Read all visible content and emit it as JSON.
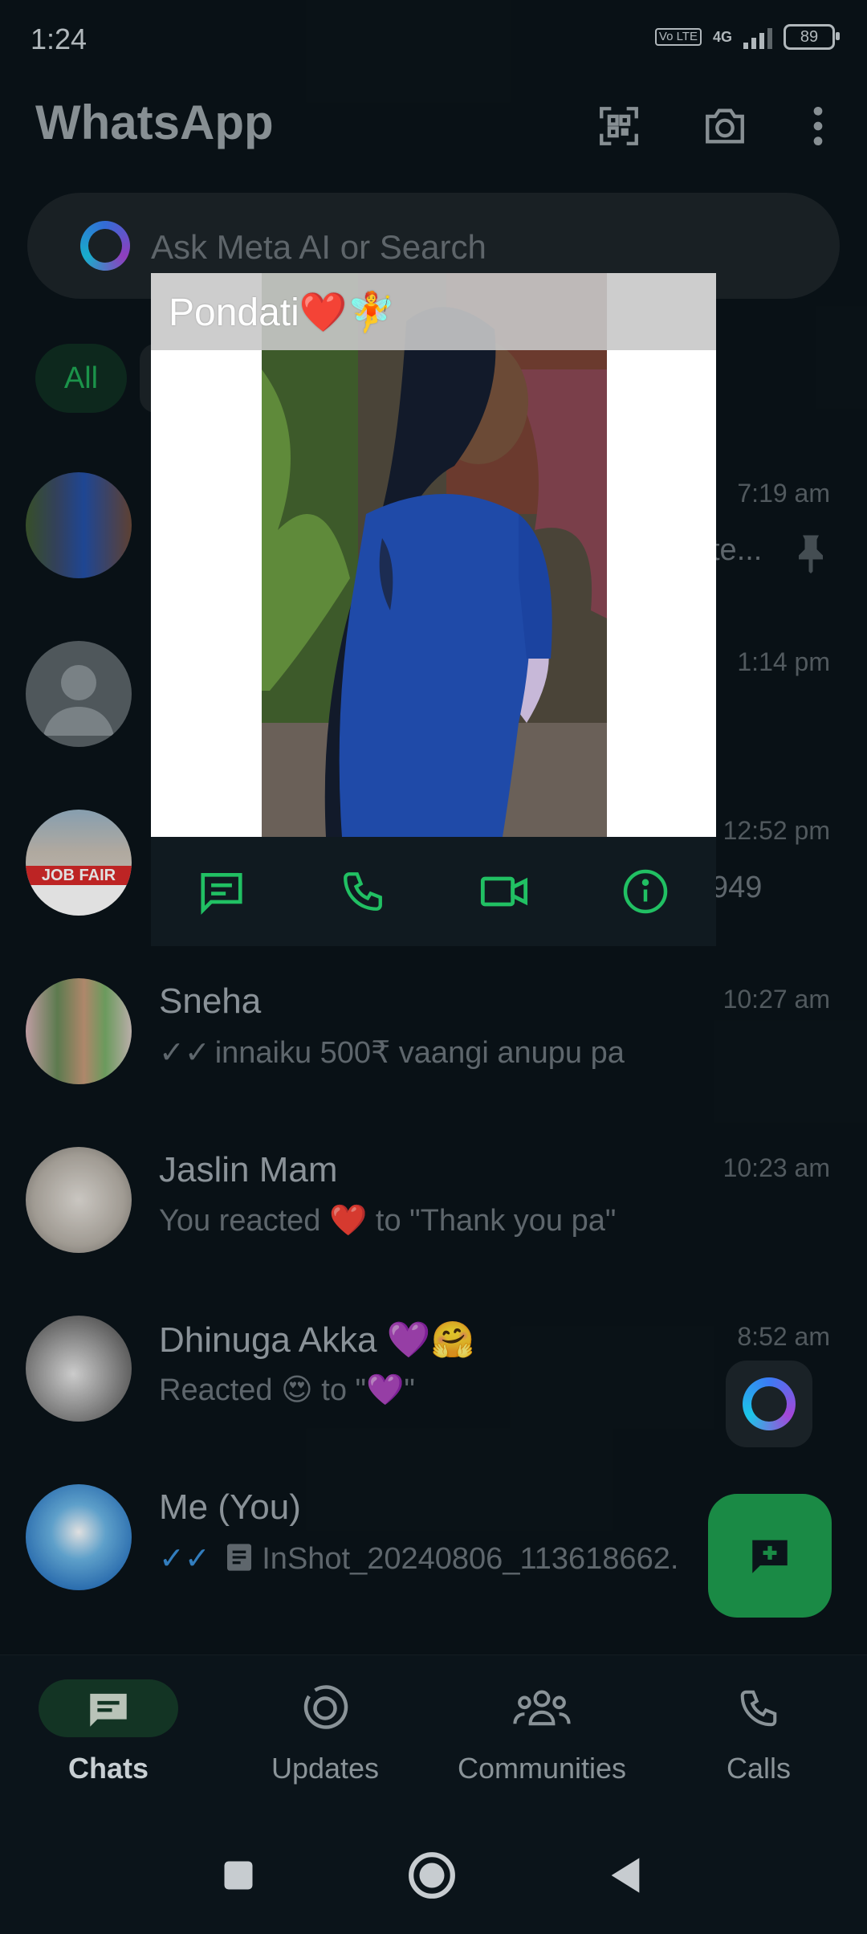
{
  "status_bar": {
    "time": "1:24",
    "volte": "Vo LTE",
    "network": "4G",
    "battery": "89"
  },
  "header": {
    "title": "WhatsApp"
  },
  "search": {
    "placeholder": "Ask Meta AI or Search"
  },
  "filters": {
    "all": "All"
  },
  "chats": [
    {
      "time": "7:19 am",
      "preview_fragment": "te...",
      "pinned": true
    },
    {
      "time": "1:14 pm"
    },
    {
      "time": "12:52 pm",
      "preview_fragment": "949"
    },
    {
      "name": "Sneha",
      "time": "10:27 am",
      "message": "innaiku 500₹ vaangi anupu pa"
    },
    {
      "name": "Jaslin Mam",
      "time": "10:23 am",
      "message_prefix": "You reacted",
      "message_emoji": "❤️",
      "message_suffix": "to \"Thank you pa\""
    },
    {
      "name": "Dhinuga Akka",
      "name_emoji": "💜🤗",
      "time": "8:52 am",
      "message_prefix": "Reacted",
      "message_emoji": "😍",
      "message_suffix": "to \"💜\""
    },
    {
      "name": "Me (You)",
      "message": "InShot_20240806_113618662."
    }
  ],
  "popup": {
    "contact_name": "Pondati❤️🧚"
  },
  "bottom_nav": {
    "chats": "Chats",
    "updates": "Updates",
    "communities": "Communities",
    "calls": "Calls"
  },
  "colors": {
    "accent": "#1fa855",
    "background": "#0b141a"
  }
}
